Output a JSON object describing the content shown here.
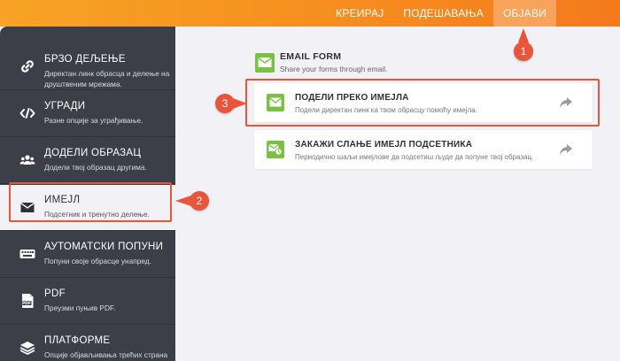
{
  "topnav": {
    "tabs": [
      {
        "label": "КРЕИРАЈ"
      },
      {
        "label": "ПОДЕШАВАЊА"
      },
      {
        "label": "ОБЈАВИ"
      }
    ]
  },
  "sidebar": {
    "items": [
      {
        "title": "БРЗО ДЕЉЕЊЕ",
        "desc": "Директан линк обрасца и делење на друштвеним мрежама.",
        "icon": "link-icon"
      },
      {
        "title": "УГРАДИ",
        "desc": "Разне опције за уграђивање.",
        "icon": "code-icon"
      },
      {
        "title": "ДОДЕЛИ ОБРАЗАЦ",
        "desc": "Додели твој образац другима.",
        "icon": "users-icon"
      },
      {
        "title": "ИМЕЈЛ",
        "desc": "Подсетник и тренутно делење.",
        "icon": "envelope-icon"
      },
      {
        "title": "АУТОМАТСКИ ПОПУНИ",
        "desc": "Попуни своје обрасце унапред.",
        "icon": "keyboard-icon"
      },
      {
        "title": "PDF",
        "desc": "Преузми пуњив PDF.",
        "icon": "pdf-icon"
      },
      {
        "title": "ПЛАТФОРМЕ",
        "desc": "Опције објављивања трећих страна",
        "icon": "layers-icon"
      }
    ]
  },
  "main": {
    "section_title": "EMAIL FORM",
    "section_sub": "Share your forms through email.",
    "cards": [
      {
        "title": "ПОДЕЛИ ПРЕКО ИМЕЈЛА",
        "desc": "Подели директан линк ка твом обрасцу помоћу имејла."
      },
      {
        "title": "ЗАКАЖИ СЛАЊЕ ИМЕЈЛ ПОДСЕТНИКА",
        "desc": "Периодично шаљи имејлове да подсетиш људе да попуне твој образац."
      }
    ]
  },
  "badges": [
    "1",
    "2",
    "3"
  ],
  "colors": {
    "accent": "#f68b1f",
    "highlight": "#e8553a",
    "green": "#78c143",
    "sidebar": "#3c3f48"
  }
}
